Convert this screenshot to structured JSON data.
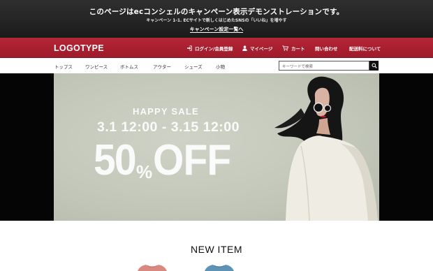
{
  "campaign": {
    "title": "このページはecコンシェルのキャンペーン表示デモンストレーションです。",
    "subtitle": "キャンペーン 1-1. ECサイトで新しくはじめたSNSの「いいね」を増やす",
    "link": "キャンペーン設定一覧へ"
  },
  "header": {
    "logo": "LOGOTYPE",
    "nav": [
      {
        "label": "ログイン/会員登録",
        "icon": "login-icon"
      },
      {
        "label": "マイページ",
        "icon": "user-icon"
      },
      {
        "label": "カート",
        "icon": "cart-icon"
      },
      {
        "label": "問い合わせ",
        "icon": ""
      },
      {
        "label": "配送料について",
        "icon": ""
      }
    ],
    "color": "#a61f30"
  },
  "categories": [
    "トップス",
    "ワンピース",
    "ボトムス",
    "アウター",
    "シューズ",
    "小物"
  ],
  "search": {
    "placeholder": "キーワードで検索",
    "icon": "search-icon"
  },
  "hero": {
    "headline": "HAPPY SALE",
    "dates": "3.1 12:00 - 3.15 12:00",
    "discount_number": "50",
    "discount_percent": "%",
    "discount_word": "OFF",
    "background": "#c6cbbd"
  },
  "new_item": {
    "title": "NEW ITEM"
  }
}
